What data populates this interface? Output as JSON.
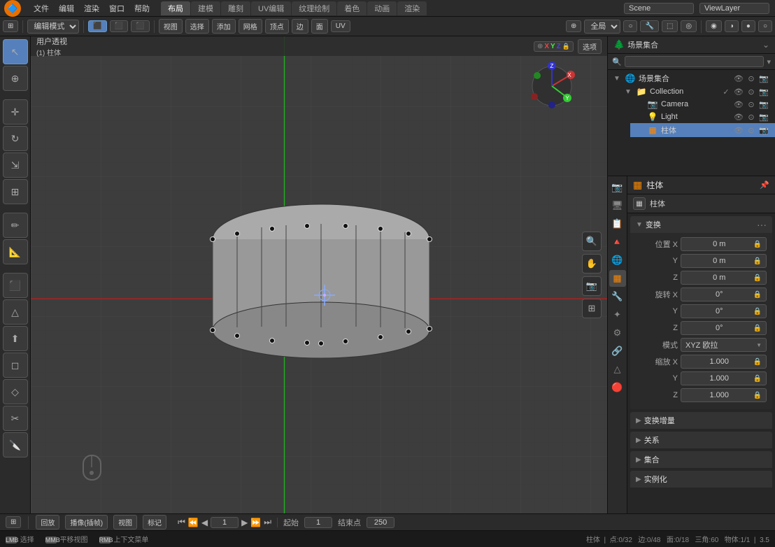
{
  "app": {
    "title": "Blender",
    "version": "3.5"
  },
  "menubar": {
    "menus": [
      "文件",
      "编辑",
      "渲染",
      "窗口",
      "帮助"
    ],
    "workspaces": [
      "布局",
      "建模",
      "雕刻",
      "UV编辑",
      "纹理绘制",
      "着色",
      "动画",
      "渲染"
    ],
    "active_workspace": "布局",
    "scene_name": "Scene",
    "viewlayer_name": "ViewLayer"
  },
  "editor_toolbar": {
    "mode_label": "编辑模式",
    "view_label": "视图",
    "select_label": "选择",
    "add_label": "添加",
    "mesh_label": "网格",
    "vertex_label": "顶点",
    "edge_label": "边",
    "face_label": "面",
    "uv_label": "UV",
    "global_label": "全局"
  },
  "viewport": {
    "mode_label": "用户透视",
    "object_name": "(1) 柱体",
    "xyz_labels": [
      "X",
      "Y",
      "Z"
    ],
    "options_label": "选项"
  },
  "outliner": {
    "title": "场景集合",
    "items": [
      {
        "name": "Collection",
        "icon": "📁",
        "indent": 1,
        "collapsed": false,
        "visible": true
      },
      {
        "name": "Camera",
        "icon": "📷",
        "indent": 2
      },
      {
        "name": "Light",
        "icon": "💡",
        "indent": 2
      },
      {
        "name": "柱体",
        "icon": "🟠",
        "indent": 2,
        "active": true
      }
    ]
  },
  "properties": {
    "object_name": "柱体",
    "object_data_name": "柱体",
    "sections": {
      "transform": {
        "title": "变换",
        "position": {
          "x": "0 m",
          "y": "0 m",
          "z": "0 m"
        },
        "rotation": {
          "x": "0°",
          "y": "0°",
          "z": "0°"
        },
        "mode": "XYZ 欧拉",
        "scale": {
          "x": "1.000",
          "y": "1.000",
          "z": "1.000"
        }
      },
      "delta_transform": "变换增量",
      "relations": "关系",
      "collection": "集合",
      "instancing": "实例化"
    }
  },
  "timeline": {
    "playback_label": "回放",
    "playback_speed": "播像(插帧)",
    "view_label": "视图",
    "marker_label": "标记",
    "current_frame": "1",
    "start_label": "起始",
    "start_frame": "1",
    "end_label": "结束点",
    "end_frame": "250",
    "transport_buttons": [
      "⏮",
      "⏪",
      "◀",
      "▶",
      "⏩",
      "⏭"
    ]
  },
  "statusbar": {
    "object_info": "柱体",
    "vertices": "点:0/32",
    "edges": "边:0/48",
    "faces": "面:0/18",
    "triangles": "三角:60",
    "memory": "物体:1/1",
    "fps": "3.5",
    "left_key": "选择",
    "middle_key": "平移视图",
    "right_key": "上下文菜单"
  },
  "icons": {
    "arrow_down": "▼",
    "arrow_right": "▶",
    "eye": "👁",
    "camera": "📷",
    "render": "🎬",
    "lock": "🔒",
    "search": "🔍",
    "gear": "⚙",
    "plus": "+",
    "minus": "-",
    "dot": "●"
  }
}
